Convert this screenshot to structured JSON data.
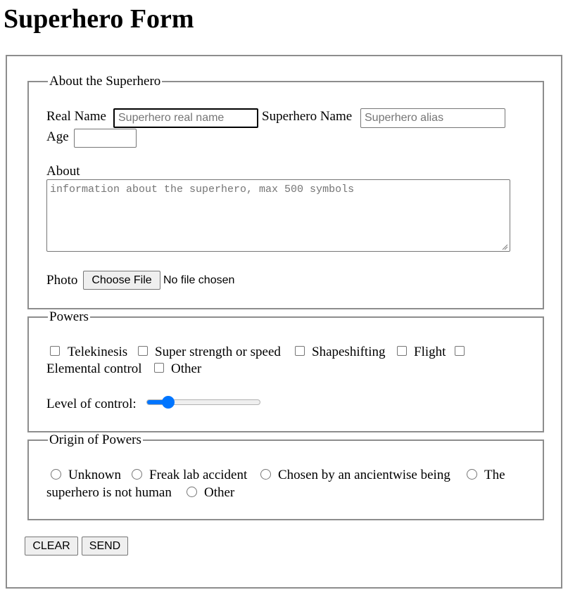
{
  "page": {
    "title": "Superhero Form"
  },
  "about_section": {
    "legend": "About the Superhero",
    "real_name_label": "Real Name",
    "real_name_placeholder": "Superhero real name",
    "alias_label": "Superhero Name",
    "alias_placeholder": "Superhero alias",
    "age_label": "Age",
    "age_value": "",
    "about_label": "About",
    "about_placeholder": "information about the superhero, max 500 symbols",
    "photo_label": "Photo",
    "choose_file_label": "Choose File",
    "file_status": "No file chosen"
  },
  "powers_section": {
    "legend": "Powers",
    "options": [
      "Telekinesis",
      "Super strength or speed",
      "Shapeshifting",
      "Flight",
      "Elemental control",
      "Other"
    ],
    "level_label": "Level of control:",
    "level_value": 0.15
  },
  "origin_section": {
    "legend": "Origin of Powers",
    "options": [
      "Unknown",
      "Freak lab accident",
      "Chosen by an ancientwise being",
      "The",
      "superhero is not human",
      "Other"
    ]
  },
  "buttons": {
    "clear": "CLEAR",
    "send": "SEND"
  },
  "colors": {
    "accent": "#0075ff",
    "border": "#8d8d8d"
  }
}
